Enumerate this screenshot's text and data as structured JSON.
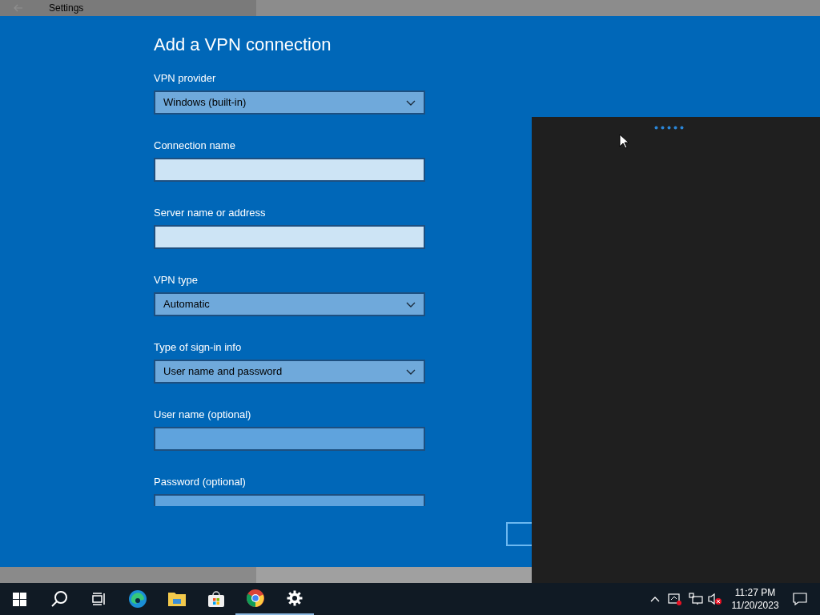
{
  "window": {
    "title": "Settings"
  },
  "dialog": {
    "title": "Add a VPN connection",
    "fields": [
      {
        "kind": "dropdown",
        "label": "VPN provider",
        "value": "Windows (built-in)",
        "disabled": false
      },
      {
        "kind": "text",
        "label": "Connection name",
        "disabled": false
      },
      {
        "kind": "text",
        "label": "Server name or address",
        "disabled": false
      },
      {
        "kind": "dropdown",
        "label": "VPN type",
        "value": "Automatic",
        "disabled": false
      },
      {
        "kind": "dropdown",
        "label": "Type of sign-in info",
        "value": "User name and password",
        "disabled": false
      },
      {
        "kind": "text",
        "label": "User name (optional)",
        "disabled": true
      },
      {
        "kind": "text",
        "label": "Password (optional)",
        "disabled": true
      }
    ]
  },
  "taskbar": {
    "apps": [
      {
        "kind": "start",
        "running": false
      },
      {
        "kind": "search",
        "running": false
      },
      {
        "kind": "taskview",
        "running": false
      },
      {
        "kind": "edge",
        "running": false
      },
      {
        "kind": "folder",
        "running": false
      },
      {
        "kind": "store",
        "running": false
      },
      {
        "kind": "chrome",
        "running": true
      },
      {
        "kind": "gear",
        "running": true
      }
    ],
    "time": "11:27 PM",
    "date": "11/20/2023"
  }
}
